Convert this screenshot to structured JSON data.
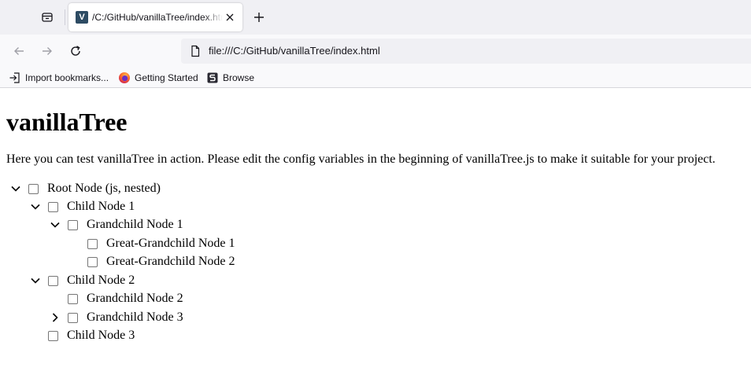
{
  "browser": {
    "tab": {
      "favicon_letter": "V",
      "title": "/C:/GitHub/vanillaTree/index.html"
    },
    "address": "file:///C:/GitHub/vanillaTree/index.html",
    "bookmarks": [
      {
        "label": "Import bookmarks...",
        "icon": "import-icon"
      },
      {
        "label": "Getting Started",
        "icon": "firefox-icon"
      },
      {
        "label": "Browse",
        "icon": "browse-icon"
      }
    ]
  },
  "page": {
    "heading": "vanillaTree",
    "intro": "Here you can test vanillaTree in action. Please edit the config variables in the beginning of vanillaTree.js to make it suitable for your project.",
    "tree": [
      {
        "label": "Root Node (js, nested)",
        "depth": 0,
        "toggle": "expanded",
        "checked": false
      },
      {
        "label": "Child Node 1",
        "depth": 1,
        "toggle": "expanded",
        "checked": false
      },
      {
        "label": "Grandchild Node 1",
        "depth": 2,
        "toggle": "expanded",
        "checked": false
      },
      {
        "label": "Great-Grandchild Node 1",
        "depth": 3,
        "toggle": "none",
        "checked": false
      },
      {
        "label": "Great-Grandchild Node 2",
        "depth": 3,
        "toggle": "none",
        "checked": false
      },
      {
        "label": "Child Node 2",
        "depth": 1,
        "toggle": "expanded",
        "checked": false
      },
      {
        "label": "Grandchild Node 2",
        "depth": 2,
        "toggle": "none",
        "checked": false
      },
      {
        "label": "Grandchild Node 3",
        "depth": 2,
        "toggle": "collapsed",
        "checked": false
      },
      {
        "label": "Child Node 3",
        "depth": 1,
        "toggle": "none",
        "checked": false
      }
    ]
  }
}
